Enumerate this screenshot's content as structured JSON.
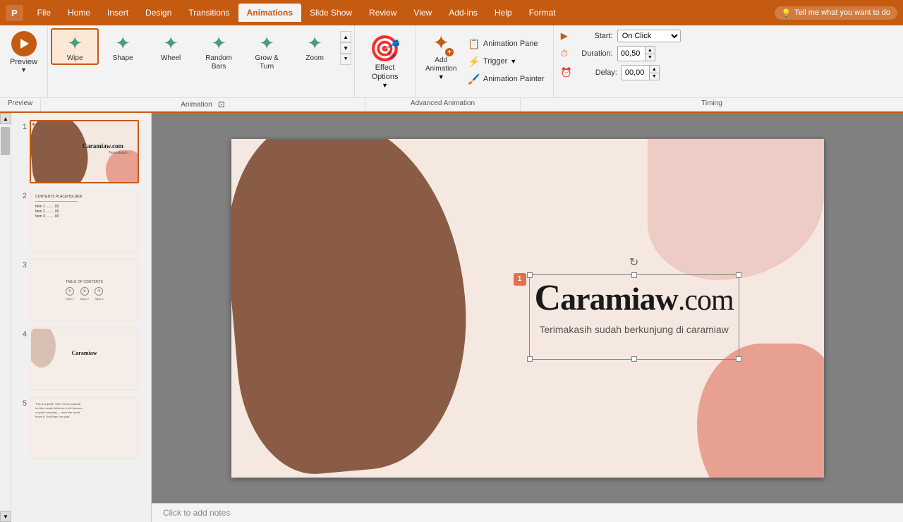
{
  "app": {
    "icon": "P",
    "title": "PowerPoint"
  },
  "tabs": [
    {
      "label": "File",
      "active": false
    },
    {
      "label": "Home",
      "active": false
    },
    {
      "label": "Insert",
      "active": false
    },
    {
      "label": "Design",
      "active": false
    },
    {
      "label": "Transitions",
      "active": false
    },
    {
      "label": "Animations",
      "active": true
    },
    {
      "label": "Slide Show",
      "active": false
    },
    {
      "label": "Review",
      "active": false
    },
    {
      "label": "View",
      "active": false
    },
    {
      "label": "Add-ins",
      "active": false
    },
    {
      "label": "Help",
      "active": false
    },
    {
      "label": "Format",
      "active": false
    }
  ],
  "tell_me": {
    "placeholder": "Tell me what you want to do",
    "icon": "💡"
  },
  "ribbon": {
    "preview_label": "Preview",
    "animation_label": "Animation",
    "advanced_label": "Advanced Animation",
    "timing_label": "Timing",
    "animations": [
      {
        "label": "Wipe",
        "icon": "⭐",
        "active": true
      },
      {
        "label": "Shape",
        "icon": "✦"
      },
      {
        "label": "Wheel",
        "icon": "✦"
      },
      {
        "label": "Random Bars",
        "icon": "✦"
      },
      {
        "label": "Grow & Turn",
        "icon": "✦"
      },
      {
        "label": "Zoom",
        "icon": "✦"
      }
    ],
    "effect_options": {
      "label": "Effect Options",
      "icon": "🎯"
    },
    "advanced": {
      "animation_pane": "Animation Pane",
      "trigger": "Trigger",
      "add_animation": "Add\nAnimation",
      "animation_painter": "Animation Painter"
    },
    "timing": {
      "start_label": "Start:",
      "start_value": "On Click",
      "duration_label": "Duration:",
      "duration_value": "00,50",
      "delay_label": "Delay:",
      "delay_value": "00,00"
    }
  },
  "slides": [
    {
      "num": "1",
      "active": true
    },
    {
      "num": "2",
      "active": false
    },
    {
      "num": "3",
      "active": false
    },
    {
      "num": "4",
      "active": false
    },
    {
      "num": "5",
      "active": false
    }
  ],
  "slide": {
    "title_c": "C",
    "title_rest": "aramiaw",
    "title_domain": ".com",
    "subtitle": "Terimakasih sudah berkunjung di caramiaw",
    "anim_badge": "1",
    "notes_placeholder": "Click to add notes"
  }
}
